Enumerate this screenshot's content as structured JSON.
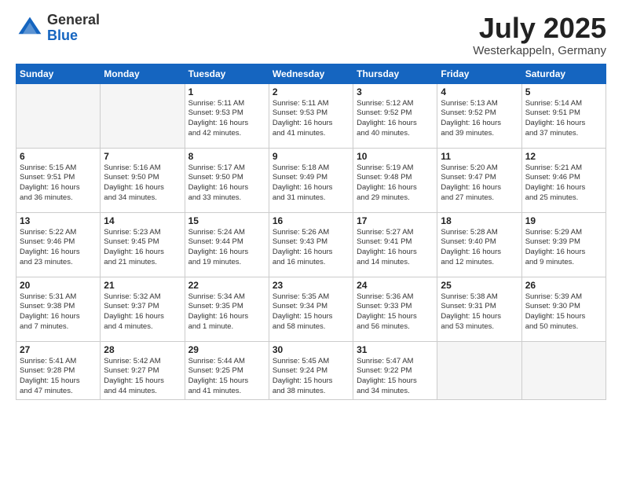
{
  "logo": {
    "general": "General",
    "blue": "Blue"
  },
  "title": "July 2025",
  "subtitle": "Westerkappeln, Germany",
  "days_header": [
    "Sunday",
    "Monday",
    "Tuesday",
    "Wednesday",
    "Thursday",
    "Friday",
    "Saturday"
  ],
  "weeks": [
    [
      {
        "day": "",
        "info": ""
      },
      {
        "day": "",
        "info": ""
      },
      {
        "day": "1",
        "info": "Sunrise: 5:11 AM\nSunset: 9:53 PM\nDaylight: 16 hours\nand 42 minutes."
      },
      {
        "day": "2",
        "info": "Sunrise: 5:11 AM\nSunset: 9:53 PM\nDaylight: 16 hours\nand 41 minutes."
      },
      {
        "day": "3",
        "info": "Sunrise: 5:12 AM\nSunset: 9:52 PM\nDaylight: 16 hours\nand 40 minutes."
      },
      {
        "day": "4",
        "info": "Sunrise: 5:13 AM\nSunset: 9:52 PM\nDaylight: 16 hours\nand 39 minutes."
      },
      {
        "day": "5",
        "info": "Sunrise: 5:14 AM\nSunset: 9:51 PM\nDaylight: 16 hours\nand 37 minutes."
      }
    ],
    [
      {
        "day": "6",
        "info": "Sunrise: 5:15 AM\nSunset: 9:51 PM\nDaylight: 16 hours\nand 36 minutes."
      },
      {
        "day": "7",
        "info": "Sunrise: 5:16 AM\nSunset: 9:50 PM\nDaylight: 16 hours\nand 34 minutes."
      },
      {
        "day": "8",
        "info": "Sunrise: 5:17 AM\nSunset: 9:50 PM\nDaylight: 16 hours\nand 33 minutes."
      },
      {
        "day": "9",
        "info": "Sunrise: 5:18 AM\nSunset: 9:49 PM\nDaylight: 16 hours\nand 31 minutes."
      },
      {
        "day": "10",
        "info": "Sunrise: 5:19 AM\nSunset: 9:48 PM\nDaylight: 16 hours\nand 29 minutes."
      },
      {
        "day": "11",
        "info": "Sunrise: 5:20 AM\nSunset: 9:47 PM\nDaylight: 16 hours\nand 27 minutes."
      },
      {
        "day": "12",
        "info": "Sunrise: 5:21 AM\nSunset: 9:46 PM\nDaylight: 16 hours\nand 25 minutes."
      }
    ],
    [
      {
        "day": "13",
        "info": "Sunrise: 5:22 AM\nSunset: 9:46 PM\nDaylight: 16 hours\nand 23 minutes."
      },
      {
        "day": "14",
        "info": "Sunrise: 5:23 AM\nSunset: 9:45 PM\nDaylight: 16 hours\nand 21 minutes."
      },
      {
        "day": "15",
        "info": "Sunrise: 5:24 AM\nSunset: 9:44 PM\nDaylight: 16 hours\nand 19 minutes."
      },
      {
        "day": "16",
        "info": "Sunrise: 5:26 AM\nSunset: 9:43 PM\nDaylight: 16 hours\nand 16 minutes."
      },
      {
        "day": "17",
        "info": "Sunrise: 5:27 AM\nSunset: 9:41 PM\nDaylight: 16 hours\nand 14 minutes."
      },
      {
        "day": "18",
        "info": "Sunrise: 5:28 AM\nSunset: 9:40 PM\nDaylight: 16 hours\nand 12 minutes."
      },
      {
        "day": "19",
        "info": "Sunrise: 5:29 AM\nSunset: 9:39 PM\nDaylight: 16 hours\nand 9 minutes."
      }
    ],
    [
      {
        "day": "20",
        "info": "Sunrise: 5:31 AM\nSunset: 9:38 PM\nDaylight: 16 hours\nand 7 minutes."
      },
      {
        "day": "21",
        "info": "Sunrise: 5:32 AM\nSunset: 9:37 PM\nDaylight: 16 hours\nand 4 minutes."
      },
      {
        "day": "22",
        "info": "Sunrise: 5:34 AM\nSunset: 9:35 PM\nDaylight: 16 hours\nand 1 minute."
      },
      {
        "day": "23",
        "info": "Sunrise: 5:35 AM\nSunset: 9:34 PM\nDaylight: 15 hours\nand 58 minutes."
      },
      {
        "day": "24",
        "info": "Sunrise: 5:36 AM\nSunset: 9:33 PM\nDaylight: 15 hours\nand 56 minutes."
      },
      {
        "day": "25",
        "info": "Sunrise: 5:38 AM\nSunset: 9:31 PM\nDaylight: 15 hours\nand 53 minutes."
      },
      {
        "day": "26",
        "info": "Sunrise: 5:39 AM\nSunset: 9:30 PM\nDaylight: 15 hours\nand 50 minutes."
      }
    ],
    [
      {
        "day": "27",
        "info": "Sunrise: 5:41 AM\nSunset: 9:28 PM\nDaylight: 15 hours\nand 47 minutes."
      },
      {
        "day": "28",
        "info": "Sunrise: 5:42 AM\nSunset: 9:27 PM\nDaylight: 15 hours\nand 44 minutes."
      },
      {
        "day": "29",
        "info": "Sunrise: 5:44 AM\nSunset: 9:25 PM\nDaylight: 15 hours\nand 41 minutes."
      },
      {
        "day": "30",
        "info": "Sunrise: 5:45 AM\nSunset: 9:24 PM\nDaylight: 15 hours\nand 38 minutes."
      },
      {
        "day": "31",
        "info": "Sunrise: 5:47 AM\nSunset: 9:22 PM\nDaylight: 15 hours\nand 34 minutes."
      },
      {
        "day": "",
        "info": ""
      },
      {
        "day": "",
        "info": ""
      }
    ]
  ]
}
